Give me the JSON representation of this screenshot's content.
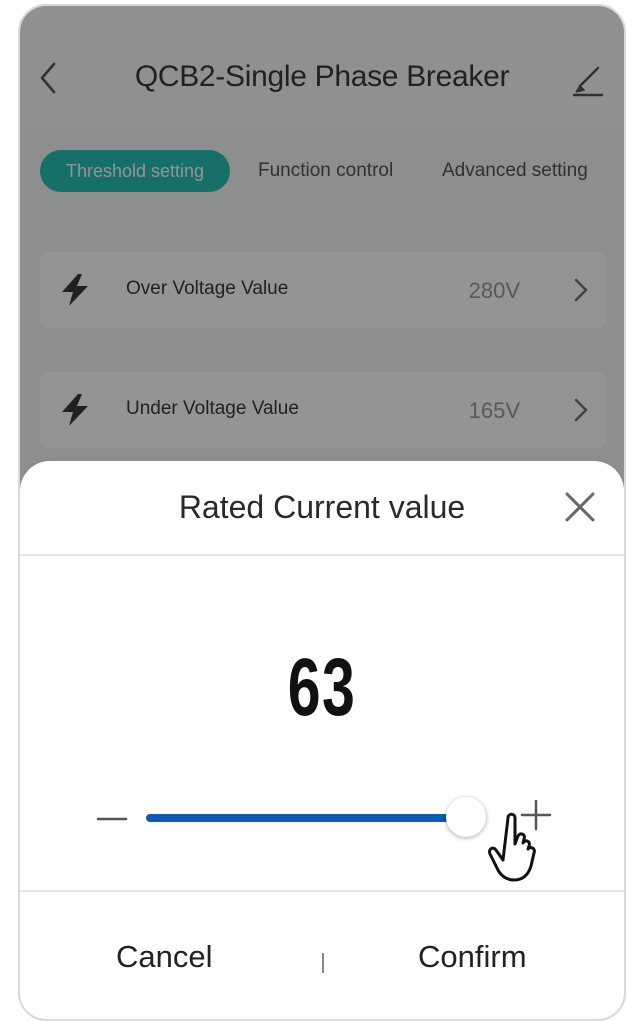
{
  "header": {
    "title": "QCB2-Single Phase Breaker"
  },
  "tabs": [
    {
      "label": "Threshold setting",
      "active": true
    },
    {
      "label": "Function control"
    },
    {
      "label": "Advanced setting"
    }
  ],
  "settings": [
    {
      "icon": "lightning-icon",
      "label": "Over Voltage Value",
      "value": "280V"
    },
    {
      "icon": "lightning-icon",
      "label": "Under Voltage Value",
      "value": "165V"
    }
  ],
  "dialog": {
    "title": "Rated Current value",
    "value": "63",
    "slider_fraction": 0.94,
    "cancel_label": "Cancel",
    "confirm_label": "Confirm"
  },
  "colors": {
    "accent_tab": "#27c0b6",
    "slider_fill": "#0e5bb0"
  }
}
